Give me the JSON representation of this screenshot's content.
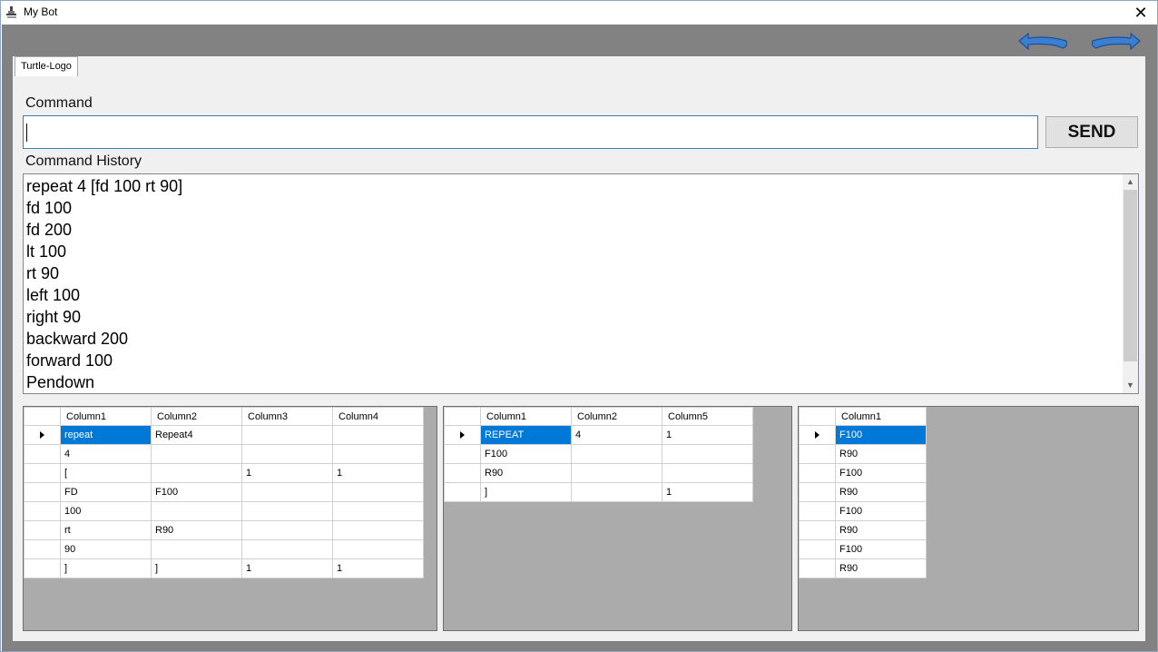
{
  "window": {
    "title": "My Bot",
    "close_glyph": "✕"
  },
  "toolbar": {
    "back_icon": "undo-arrow-icon",
    "forward_icon": "redo-arrow-icon"
  },
  "tabs": [
    {
      "label": "Turtle-Logo"
    }
  ],
  "command": {
    "label": "Command",
    "value": "",
    "send_label": "SEND"
  },
  "history": {
    "label": "Command History",
    "items": [
      "repeat 4 [fd 100 rt 90]",
      "fd 100",
      "fd 200",
      "lt 100",
      "rt 90",
      "left 100",
      "right 90",
      "backward 200",
      "forward 100",
      "Pendown"
    ]
  },
  "grid1": {
    "columns": [
      "Column1",
      "Column2",
      "Column3",
      "Column4"
    ],
    "rows": [
      [
        "repeat",
        "Repeat4",
        "",
        ""
      ],
      [
        "4",
        "",
        "",
        ""
      ],
      [
        "[",
        "",
        "1",
        "1"
      ],
      [
        "FD",
        "F100",
        "",
        ""
      ],
      [
        "100",
        "",
        "",
        ""
      ],
      [
        "rt",
        "R90",
        "",
        ""
      ],
      [
        "90",
        "",
        "",
        ""
      ],
      [
        "]",
        "]",
        "1",
        "1"
      ]
    ]
  },
  "grid2": {
    "columns": [
      "Column1",
      "Column2",
      "Column5"
    ],
    "rows": [
      [
        "REPEAT",
        "4",
        "1"
      ],
      [
        "F100",
        "",
        ""
      ],
      [
        "R90",
        "",
        ""
      ],
      [
        "]",
        "",
        "1"
      ]
    ]
  },
  "grid3": {
    "columns": [
      "Column1"
    ],
    "rows": [
      [
        "F100"
      ],
      [
        "R90"
      ],
      [
        "F100"
      ],
      [
        "R90"
      ],
      [
        "F100"
      ],
      [
        "R90"
      ],
      [
        "F100"
      ],
      [
        "R90"
      ]
    ]
  },
  "colors": {
    "selection": "#0078d7",
    "client_bg": "#828282",
    "grid_bg": "#ababab",
    "panel_bg": "#f0f0f0"
  }
}
